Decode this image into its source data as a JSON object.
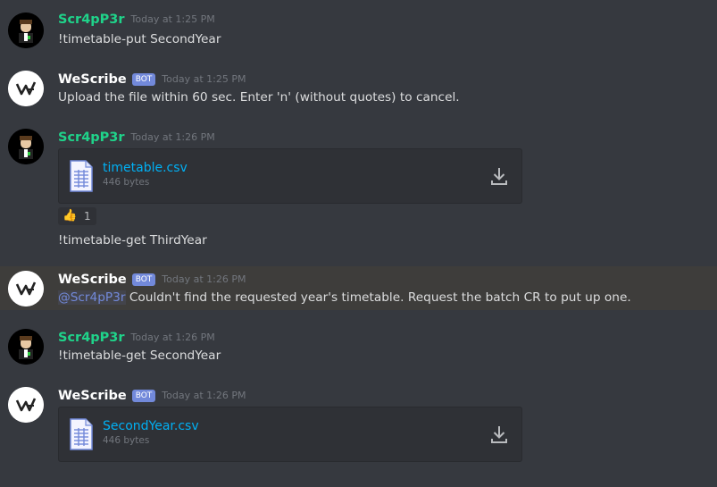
{
  "messages": [
    {
      "author": "Scr4pP3r",
      "time": "Today at 1:25 PM",
      "text": "!timetable-put SecondYear"
    },
    {
      "author": "WeScribe",
      "badge": "BOT",
      "time": "Today at 1:25 PM",
      "text": "Upload the file within 60 sec. Enter 'n' (without quotes) to cancel."
    },
    {
      "author": "Scr4pP3r",
      "time": "Today at 1:26 PM",
      "attachment": {
        "name": "timetable.csv",
        "size": "446 bytes"
      },
      "reaction": {
        "emoji": "👍",
        "count": "1"
      },
      "text": "!timetable-get ThirdYear"
    },
    {
      "author": "WeScribe",
      "badge": "BOT",
      "time": "Today at 1:26 PM",
      "mention": "@Scr4pP3r",
      "text": " Couldn't find the requested year's timetable. Request the batch CR to put up one."
    },
    {
      "author": "Scr4pP3r",
      "time": "Today at 1:26 PM",
      "text": "!timetable-get SecondYear"
    },
    {
      "author": "WeScribe",
      "badge": "BOT",
      "time": "Today at 1:26 PM",
      "attachment": {
        "name": "SecondYear.csv",
        "size": "446 bytes"
      }
    }
  ],
  "colors": {
    "user": "#1fd38a",
    "bot_badge": "#7289da",
    "link": "#00b0f4",
    "highlight": "#3e3d3b"
  }
}
